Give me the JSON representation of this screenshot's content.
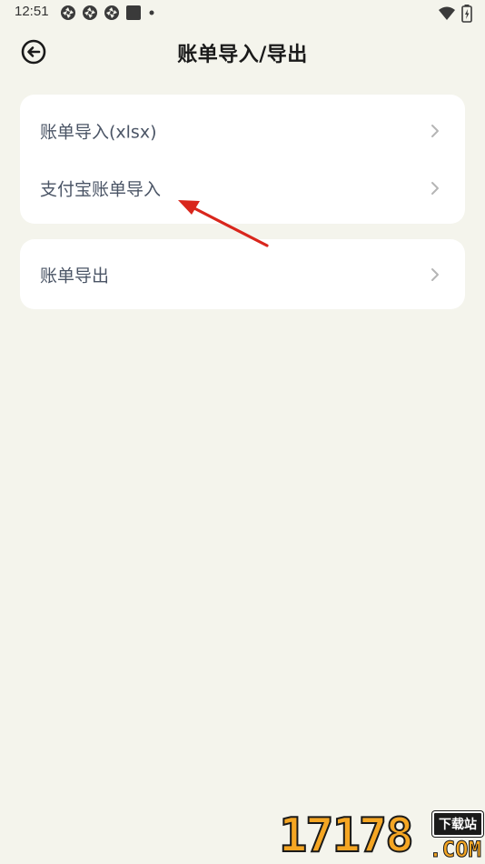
{
  "status_bar": {
    "time": "12:51",
    "left_icons": [
      "notification-icon",
      "notification-icon",
      "notification-icon",
      "app-icon",
      "dot-icon"
    ],
    "right_icons": [
      "wifi-icon",
      "battery-icon"
    ]
  },
  "header": {
    "title": "账单导入/导出",
    "back_icon": "back-circle-icon"
  },
  "card_import": {
    "items": [
      {
        "label": "账单导入(xlsx)",
        "icon": "chevron-right-icon"
      },
      {
        "label": "支付宝账单导入",
        "icon": "chevron-right-icon"
      }
    ]
  },
  "card_export": {
    "items": [
      {
        "label": "账单导出",
        "icon": "chevron-right-icon"
      }
    ]
  },
  "annotation": {
    "arrow_color": "#d9261c"
  },
  "watermark": {
    "number": "17178",
    "tag": "下载站",
    "domain": ".COM"
  },
  "colors": {
    "background": "#f4f4ec",
    "card": "#ffffff",
    "label": "#4b5566",
    "chevron": "#b5b5b5",
    "watermark_accent": "#f5a623"
  }
}
